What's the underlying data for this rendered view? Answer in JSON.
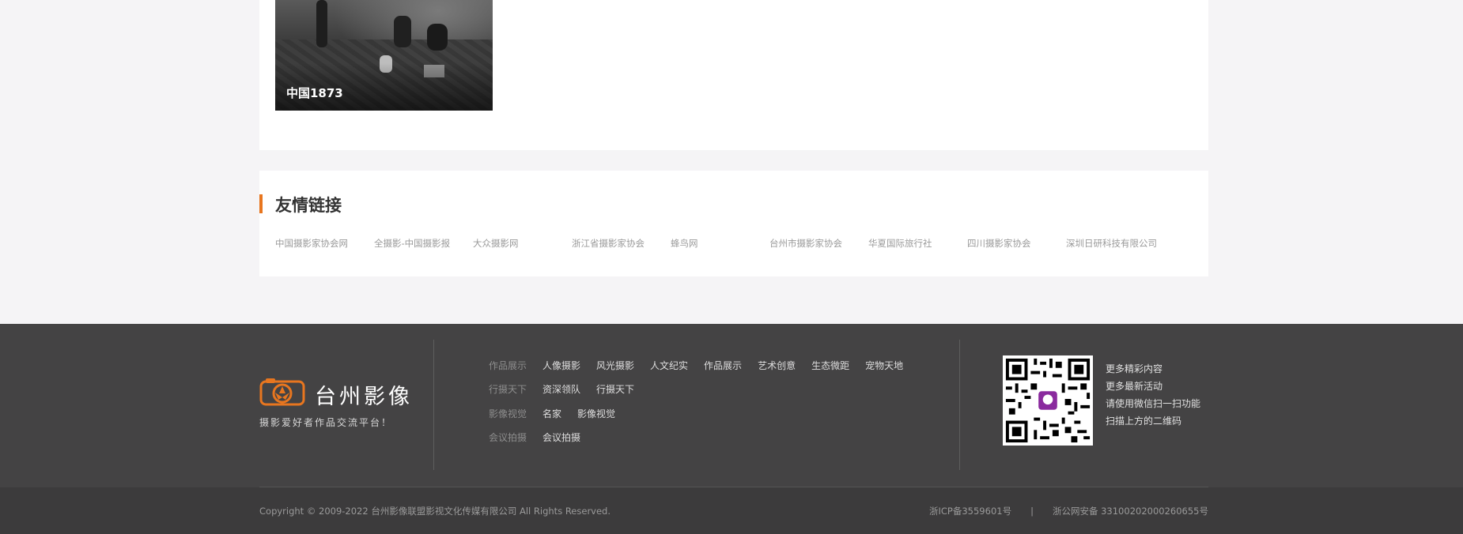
{
  "gallery": {
    "item_title": "中国1873"
  },
  "friend_links": {
    "title": "友情链接",
    "items": [
      "中国摄影家协会网",
      "全摄影-中国摄影报",
      "大众摄影网",
      "浙江省摄影家协会",
      "蜂鸟网",
      "台州市摄影家协会",
      "华夏国际旅行社",
      "四川摄影家协会",
      "深圳日研科技有限公司"
    ]
  },
  "footer": {
    "brand_name": "台州影像",
    "slogan": "摄影爱好者作品交流平台！",
    "accent_color": "#e8761f",
    "nav": [
      {
        "head": "作品展示",
        "items": [
          "人像摄影",
          "风光摄影",
          "人文纪实",
          "作品展示",
          "艺术创意",
          "生态微距",
          "宠物天地"
        ]
      },
      {
        "head": "行摄天下",
        "items": [
          "资深领队",
          "行摄天下"
        ]
      },
      {
        "head": "影像视觉",
        "items": [
          "名家",
          "影像视觉"
        ]
      },
      {
        "head": "会议拍摄",
        "items": [
          "会议拍摄"
        ]
      }
    ],
    "qr_lines": [
      "更多精彩内容",
      "更多最新活动",
      "请使用微信扫一扫功能",
      "扫描上方的二维码"
    ]
  },
  "bottom": {
    "copyright": "Copyright © 2009-2022 台州影像联盟影视文化传媒有限公司 All Rights Reserved.",
    "icp": "浙ICP备3559601号",
    "separator": "|",
    "police": "浙公网安备 33100202000260655号"
  }
}
